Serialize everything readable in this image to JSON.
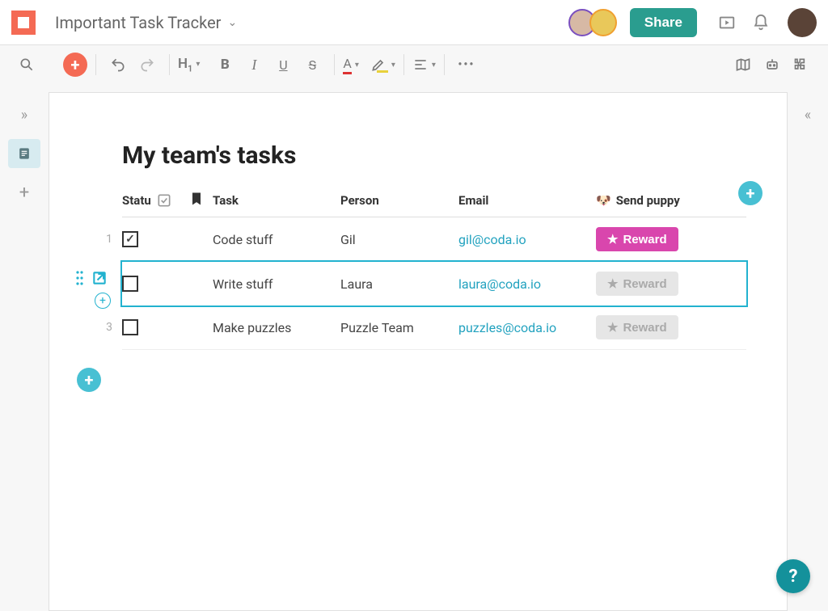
{
  "header": {
    "doc_title": "Important Task Tracker",
    "share_label": "Share"
  },
  "doc": {
    "heading": "My team's tasks"
  },
  "columns": {
    "status": "Statu",
    "task": "Task",
    "person": "Person",
    "email": "Email",
    "reward": "Send puppy"
  },
  "rows": [
    {
      "num": "1",
      "checked": true,
      "task": "Code stuff",
      "person": "Gil",
      "email": "gil@coda.io",
      "reward_label": "Reward",
      "reward_enabled": true
    },
    {
      "num": "",
      "checked": false,
      "task": "Write stuff",
      "person": "Laura",
      "email": "laura@coda.io",
      "reward_label": "Reward",
      "reward_enabled": false,
      "selected": true
    },
    {
      "num": "3",
      "checked": false,
      "task": "Make puzzles",
      "person": "Puzzle Team",
      "email": "puzzles@coda.io",
      "reward_label": "Reward",
      "reward_enabled": false
    }
  ],
  "colors": {
    "brand_orange": "#f46a54",
    "accent_teal": "#2a9d8f",
    "link_blue": "#22a2bf",
    "pink": "#d946ad",
    "cyan": "#48c0d3"
  }
}
